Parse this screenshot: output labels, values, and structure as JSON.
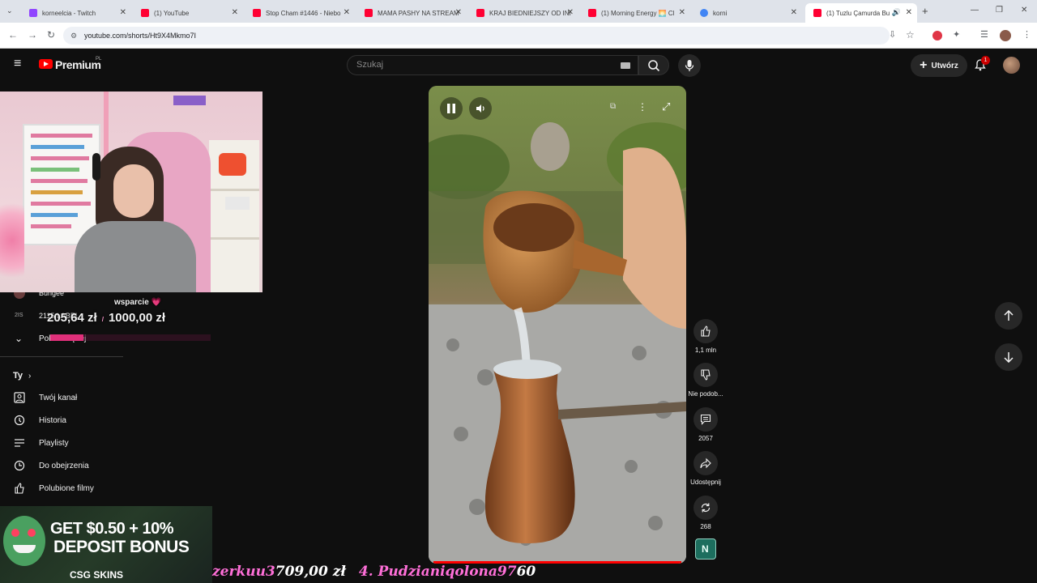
{
  "browser": {
    "tabs": [
      {
        "title": "korneelcia - Twitch",
        "favicon_color": "#9146ff"
      },
      {
        "title": "(1) YouTube",
        "favicon_color": "#ff0033"
      },
      {
        "title": "Stop Cham #1446 - Niebo",
        "favicon_color": "#ff0033"
      },
      {
        "title": "MAMA PASHY NA STREAM",
        "favicon_color": "#ff0033"
      },
      {
        "title": "KRAJ BIEDNIEJSZY OD INDII",
        "favicon_color": "#ff0033"
      },
      {
        "title": "(1) Morning Energy 🌅 Cl",
        "favicon_color": "#ff0033"
      },
      {
        "title": "korni",
        "favicon_color": "#4285f4"
      },
      {
        "title": "(1) Tuzlu Çamurda Bu",
        "favicon_color": "#ff0033"
      }
    ],
    "new_tab": "+",
    "url": "youtube.com/shorts/Ht9X4Mkmo7I"
  },
  "youtube": {
    "logo_text": "Premium",
    "logo_region": "PL",
    "search_placeholder": "Szukaj",
    "create_label": "Utwórz",
    "notification_count": "1"
  },
  "overlay": {
    "donation_label": "wsparcie 💗",
    "donation_amount": "205,64 zł",
    "donation_separator": "/",
    "donation_goal": "1000,00 zł",
    "donation_progress": 0.2056,
    "ticker_name_1": "zerkuu3",
    "ticker_amount_1": "709,00 zł",
    "ticker_rank_2": "4.",
    "ticker_name_2": "Pudzianiqolona97",
    "ticker_amount_2": "60"
  },
  "sidebar": {
    "sub_items": [
      {
        "label": "Bungee"
      },
      {
        "label": "2115 LABEL"
      }
    ],
    "show_more": "Pokaż więcej",
    "section_title": "Ty",
    "items": [
      {
        "label": "Twój kanał",
        "icon": "channel-icon"
      },
      {
        "label": "Historia",
        "icon": "history-icon"
      },
      {
        "label": "Playlisty",
        "icon": "playlist-icon"
      },
      {
        "label": "Do obejrzenia",
        "icon": "watch-later-icon"
      },
      {
        "label": "Polubione filmy",
        "icon": "like-icon"
      }
    ]
  },
  "actions": {
    "like_count": "1,1 mln",
    "dislike_label": "Nie podob...",
    "comment_count": "2057",
    "share_label": "Udostępnij",
    "remix_count": "268"
  },
  "ad": {
    "line1": "GET $0.50 + 10%",
    "line2": "DEPOSIT BONUS",
    "brand": "CSG SKINS"
  },
  "colors": {
    "accent": "#ff0000",
    "ticker_white": "#ffffff",
    "ticker_pink": "#ff6fd8"
  }
}
